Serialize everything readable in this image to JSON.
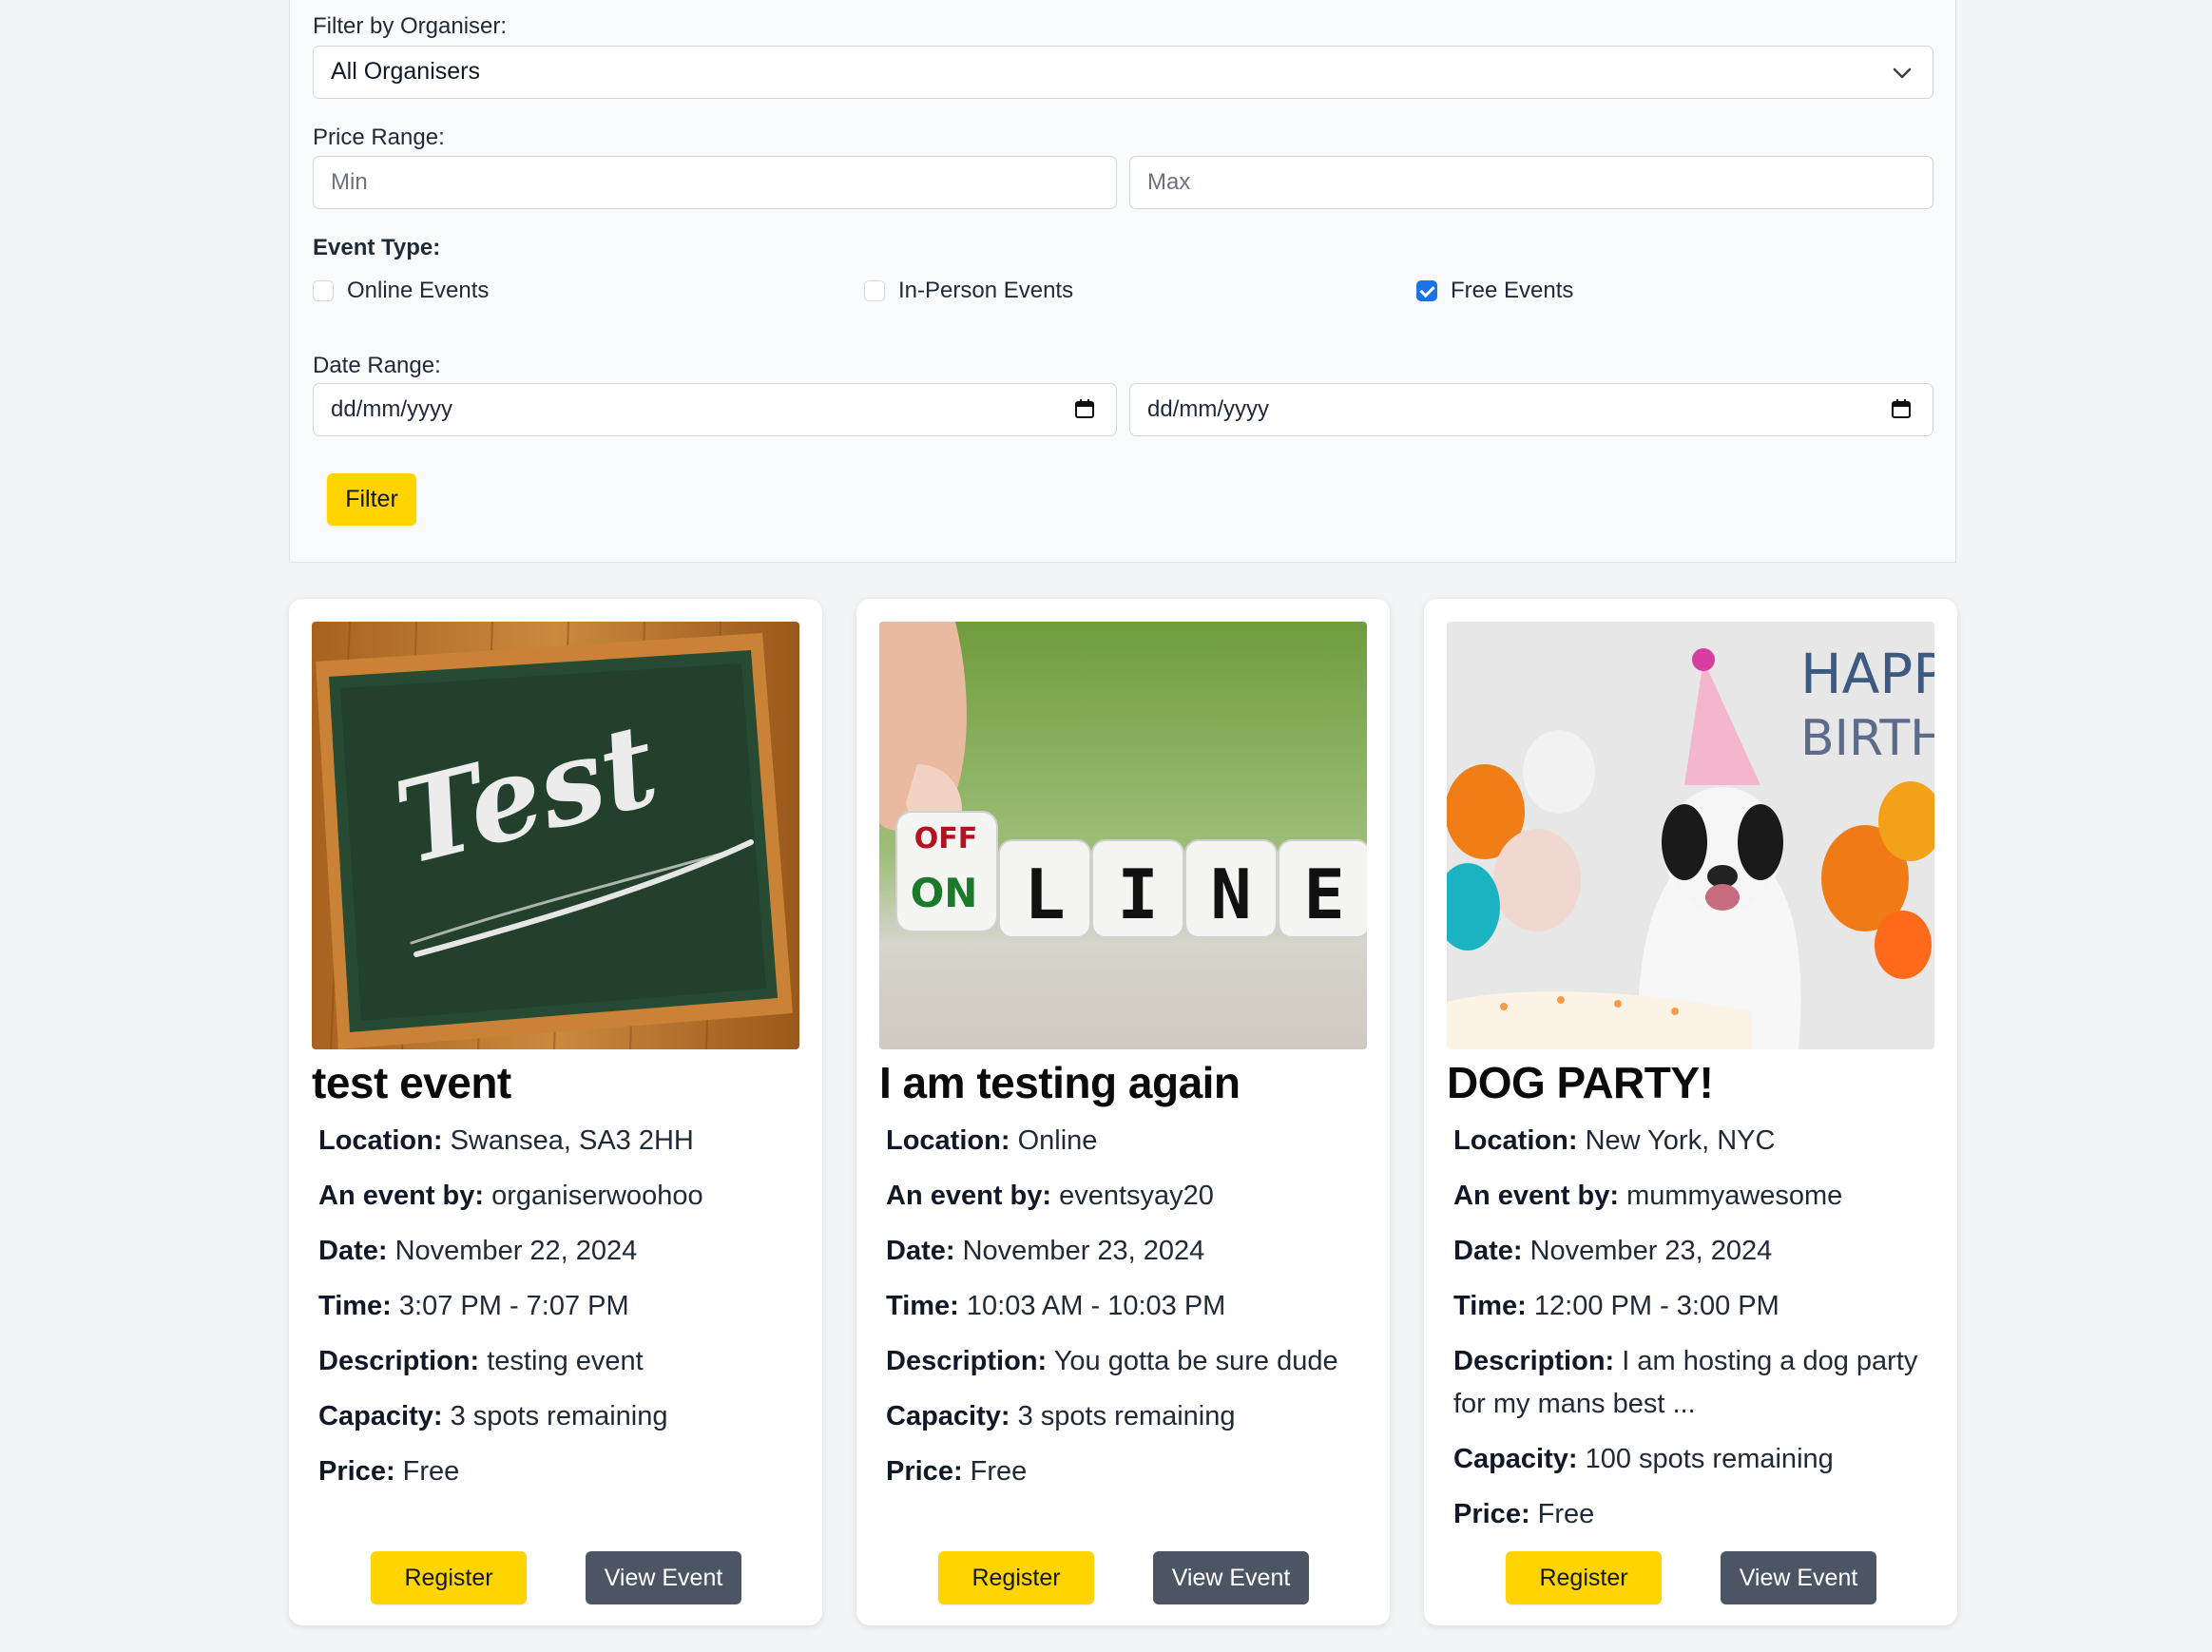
{
  "filters": {
    "organiser_label": "Filter by Organiser:",
    "organiser_value": "All Organisers",
    "price_label": "Price Range:",
    "price_min_placeholder": "Min",
    "price_max_placeholder": "Max",
    "event_type_label": "Event Type:",
    "event_types": [
      {
        "label": "Online Events",
        "checked": false
      },
      {
        "label": "In-Person Events",
        "checked": false
      },
      {
        "label": "Free Events",
        "checked": true
      }
    ],
    "date_label": "Date Range:",
    "date_start": "dd/mm/yyyy",
    "date_end": "dd/mm/yyyy",
    "filter_button": "Filter"
  },
  "labels": {
    "location": "Location:",
    "organiser": "An event by:",
    "date": "Date:",
    "time": "Time:",
    "description": "Description:",
    "capacity": "Capacity:",
    "price": "Price:",
    "register": "Register",
    "view": "View Event"
  },
  "events": [
    {
      "title": "test event",
      "image": "chalkboard-test-image",
      "image_text": "Test",
      "location": "Swansea, SA3 2HH",
      "organiser": "organiserwoohoo",
      "date": "November 22, 2024",
      "time": "3:07 PM - 7:07 PM",
      "description": "testing event",
      "capacity": "3 spots remaining",
      "price": "Free"
    },
    {
      "title": "I am testing again",
      "image": "online-dice-image",
      "image_text_off": "OFF",
      "image_text_on": "ON",
      "image_text_letters": [
        "L",
        "I",
        "N",
        "E"
      ],
      "location": "Online",
      "organiser": "eventsyay20",
      "date": "November 23, 2024",
      "time": "10:03 AM - 10:03 PM",
      "description": "You gotta be sure dude",
      "capacity": "3 spots remaining",
      "price": "Free"
    },
    {
      "title": "DOG PARTY!",
      "image": "dog-birthday-image",
      "image_text_1": "HAPP",
      "image_text_2": "BIRTHDA",
      "location": "New York, NYC",
      "organiser": "mummyawesome",
      "date": "November 23, 2024",
      "time": "12:00 PM - 3:00 PM",
      "description": "I am hosting a dog party for my mans best ...",
      "capacity": "100 spots remaining",
      "price": "Free"
    }
  ],
  "colors": {
    "accent_yellow": "#ffd400",
    "button_gray": "#4b5563",
    "checkbox_blue": "#1a73e8"
  }
}
